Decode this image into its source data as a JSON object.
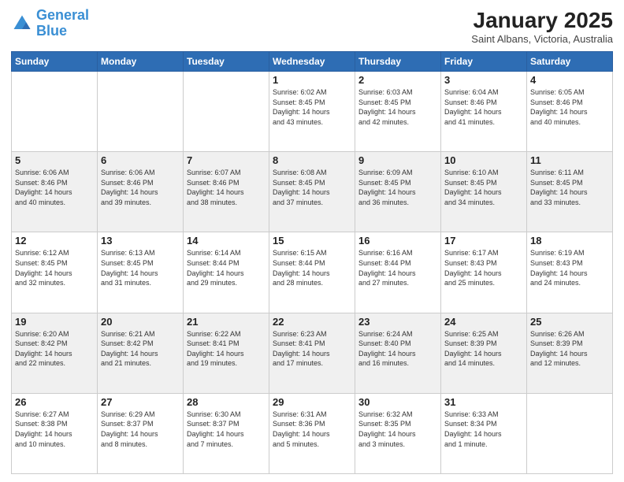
{
  "header": {
    "logo_line1": "General",
    "logo_line2": "Blue",
    "month_title": "January 2025",
    "subtitle": "Saint Albans, Victoria, Australia"
  },
  "weekdays": [
    "Sunday",
    "Monday",
    "Tuesday",
    "Wednesday",
    "Thursday",
    "Friday",
    "Saturday"
  ],
  "weeks": [
    [
      {
        "day": "",
        "info": ""
      },
      {
        "day": "",
        "info": ""
      },
      {
        "day": "",
        "info": ""
      },
      {
        "day": "1",
        "info": "Sunrise: 6:02 AM\nSunset: 8:45 PM\nDaylight: 14 hours\nand 43 minutes."
      },
      {
        "day": "2",
        "info": "Sunrise: 6:03 AM\nSunset: 8:45 PM\nDaylight: 14 hours\nand 42 minutes."
      },
      {
        "day": "3",
        "info": "Sunrise: 6:04 AM\nSunset: 8:46 PM\nDaylight: 14 hours\nand 41 minutes."
      },
      {
        "day": "4",
        "info": "Sunrise: 6:05 AM\nSunset: 8:46 PM\nDaylight: 14 hours\nand 40 minutes."
      }
    ],
    [
      {
        "day": "5",
        "info": "Sunrise: 6:06 AM\nSunset: 8:46 PM\nDaylight: 14 hours\nand 40 minutes."
      },
      {
        "day": "6",
        "info": "Sunrise: 6:06 AM\nSunset: 8:46 PM\nDaylight: 14 hours\nand 39 minutes."
      },
      {
        "day": "7",
        "info": "Sunrise: 6:07 AM\nSunset: 8:46 PM\nDaylight: 14 hours\nand 38 minutes."
      },
      {
        "day": "8",
        "info": "Sunrise: 6:08 AM\nSunset: 8:45 PM\nDaylight: 14 hours\nand 37 minutes."
      },
      {
        "day": "9",
        "info": "Sunrise: 6:09 AM\nSunset: 8:45 PM\nDaylight: 14 hours\nand 36 minutes."
      },
      {
        "day": "10",
        "info": "Sunrise: 6:10 AM\nSunset: 8:45 PM\nDaylight: 14 hours\nand 34 minutes."
      },
      {
        "day": "11",
        "info": "Sunrise: 6:11 AM\nSunset: 8:45 PM\nDaylight: 14 hours\nand 33 minutes."
      }
    ],
    [
      {
        "day": "12",
        "info": "Sunrise: 6:12 AM\nSunset: 8:45 PM\nDaylight: 14 hours\nand 32 minutes."
      },
      {
        "day": "13",
        "info": "Sunrise: 6:13 AM\nSunset: 8:45 PM\nDaylight: 14 hours\nand 31 minutes."
      },
      {
        "day": "14",
        "info": "Sunrise: 6:14 AM\nSunset: 8:44 PM\nDaylight: 14 hours\nand 29 minutes."
      },
      {
        "day": "15",
        "info": "Sunrise: 6:15 AM\nSunset: 8:44 PM\nDaylight: 14 hours\nand 28 minutes."
      },
      {
        "day": "16",
        "info": "Sunrise: 6:16 AM\nSunset: 8:44 PM\nDaylight: 14 hours\nand 27 minutes."
      },
      {
        "day": "17",
        "info": "Sunrise: 6:17 AM\nSunset: 8:43 PM\nDaylight: 14 hours\nand 25 minutes."
      },
      {
        "day": "18",
        "info": "Sunrise: 6:19 AM\nSunset: 8:43 PM\nDaylight: 14 hours\nand 24 minutes."
      }
    ],
    [
      {
        "day": "19",
        "info": "Sunrise: 6:20 AM\nSunset: 8:42 PM\nDaylight: 14 hours\nand 22 minutes."
      },
      {
        "day": "20",
        "info": "Sunrise: 6:21 AM\nSunset: 8:42 PM\nDaylight: 14 hours\nand 21 minutes."
      },
      {
        "day": "21",
        "info": "Sunrise: 6:22 AM\nSunset: 8:41 PM\nDaylight: 14 hours\nand 19 minutes."
      },
      {
        "day": "22",
        "info": "Sunrise: 6:23 AM\nSunset: 8:41 PM\nDaylight: 14 hours\nand 17 minutes."
      },
      {
        "day": "23",
        "info": "Sunrise: 6:24 AM\nSunset: 8:40 PM\nDaylight: 14 hours\nand 16 minutes."
      },
      {
        "day": "24",
        "info": "Sunrise: 6:25 AM\nSunset: 8:39 PM\nDaylight: 14 hours\nand 14 minutes."
      },
      {
        "day": "25",
        "info": "Sunrise: 6:26 AM\nSunset: 8:39 PM\nDaylight: 14 hours\nand 12 minutes."
      }
    ],
    [
      {
        "day": "26",
        "info": "Sunrise: 6:27 AM\nSunset: 8:38 PM\nDaylight: 14 hours\nand 10 minutes."
      },
      {
        "day": "27",
        "info": "Sunrise: 6:29 AM\nSunset: 8:37 PM\nDaylight: 14 hours\nand 8 minutes."
      },
      {
        "day": "28",
        "info": "Sunrise: 6:30 AM\nSunset: 8:37 PM\nDaylight: 14 hours\nand 7 minutes."
      },
      {
        "day": "29",
        "info": "Sunrise: 6:31 AM\nSunset: 8:36 PM\nDaylight: 14 hours\nand 5 minutes."
      },
      {
        "day": "30",
        "info": "Sunrise: 6:32 AM\nSunset: 8:35 PM\nDaylight: 14 hours\nand 3 minutes."
      },
      {
        "day": "31",
        "info": "Sunrise: 6:33 AM\nSunset: 8:34 PM\nDaylight: 14 hours\nand 1 minute."
      },
      {
        "day": "",
        "info": ""
      }
    ]
  ]
}
